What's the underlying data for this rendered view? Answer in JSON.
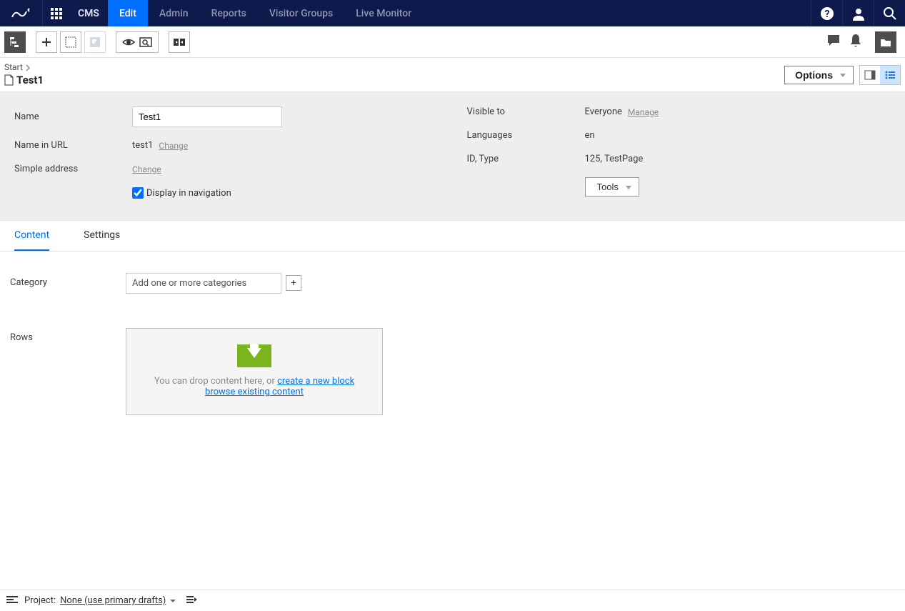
{
  "topnav": {
    "product": "CMS",
    "items": [
      "Edit",
      "Admin",
      "Reports",
      "Visitor Groups",
      "Live Monitor"
    ],
    "active": 0
  },
  "breadcrumb": {
    "parent": "Start",
    "page": "Test1",
    "options_label": "Options"
  },
  "properties": {
    "name_label": "Name",
    "name_value": "Test1",
    "url_label": "Name in URL",
    "url_value": "test1",
    "url_change": "Change",
    "simple_addr_label": "Simple address",
    "simple_addr_change": "Change",
    "display_nav_label": "Display in navigation",
    "visible_label": "Visible to",
    "visible_value": "Everyone",
    "visible_manage": "Manage",
    "languages_label": "Languages",
    "languages_value": "en",
    "idtype_label": "ID, Type",
    "idtype_value": "125, TestPage",
    "tools_label": "Tools"
  },
  "tabs": [
    "Content",
    "Settings"
  ],
  "fields": {
    "category_label": "Category",
    "category_placeholder": "Add one or more categories",
    "rows_label": "Rows",
    "drop_text_prefix": "You can drop content here, or ",
    "drop_link_create": "create a new block",
    "drop_link_browse": "browse existing content"
  },
  "bottom": {
    "project_label": "Project:",
    "project_value": "None (use primary drafts)"
  }
}
